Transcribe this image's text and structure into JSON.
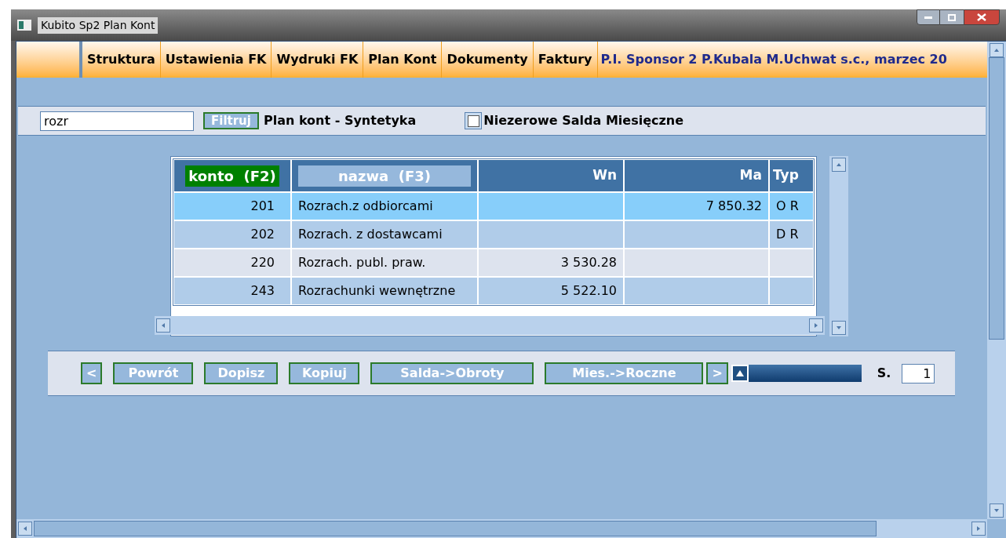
{
  "window": {
    "title": "Kubito Sp2 Plan Kont"
  },
  "menu": [
    {
      "label": "Struktura"
    },
    {
      "label": "Ustawienia FK"
    },
    {
      "label": "Wydruki FK"
    },
    {
      "label": "Plan Kont"
    },
    {
      "label": "Dokumenty"
    },
    {
      "label": "Faktury"
    }
  ],
  "company": "P.I. Sponsor 2 P.Kubala M.Uchwat s.c., marzec 20",
  "filter": {
    "value": "rozr",
    "button": "Filtruj",
    "view_title": "Plan kont - Syntetyka",
    "checkbox": {
      "label": "Niezerowe Salda Miesięczne",
      "checked": false
    }
  },
  "table": {
    "columns": [
      {
        "label": "konto  (F2)",
        "kind": "sorted"
      },
      {
        "label": "nazwa  (F3)",
        "kind": "sortable"
      },
      {
        "label": "Wn",
        "kind": "plain"
      },
      {
        "label": "Ma",
        "kind": "plain"
      },
      {
        "label": "Typ",
        "kind": "plain"
      }
    ],
    "rows": [
      {
        "selected": true,
        "cells": [
          "201",
          "Rozrach.z odbiorcami",
          "",
          "7 850.32",
          "O R"
        ]
      },
      {
        "selected": false,
        "cells": [
          "202",
          "Rozrach. z dostawcami",
          "",
          "",
          "D R"
        ]
      },
      {
        "selected": false,
        "cells": [
          "220",
          "Rozrach. publ. praw.",
          "3 530.28",
          "",
          ""
        ]
      },
      {
        "selected": false,
        "cells": [
          "243",
          "Rozrachunki wewnętrzne",
          "5 522.10",
          "",
          ""
        ]
      }
    ]
  },
  "actions": {
    "prev": "<",
    "buttons": [
      "Powrót",
      "Dopisz",
      "Kopiuj",
      "Salda->Obroty",
      "Mies.->Roczne"
    ],
    "next": ">",
    "slider": {
      "level": 0
    },
    "page_label": "S.",
    "page": "1"
  }
}
